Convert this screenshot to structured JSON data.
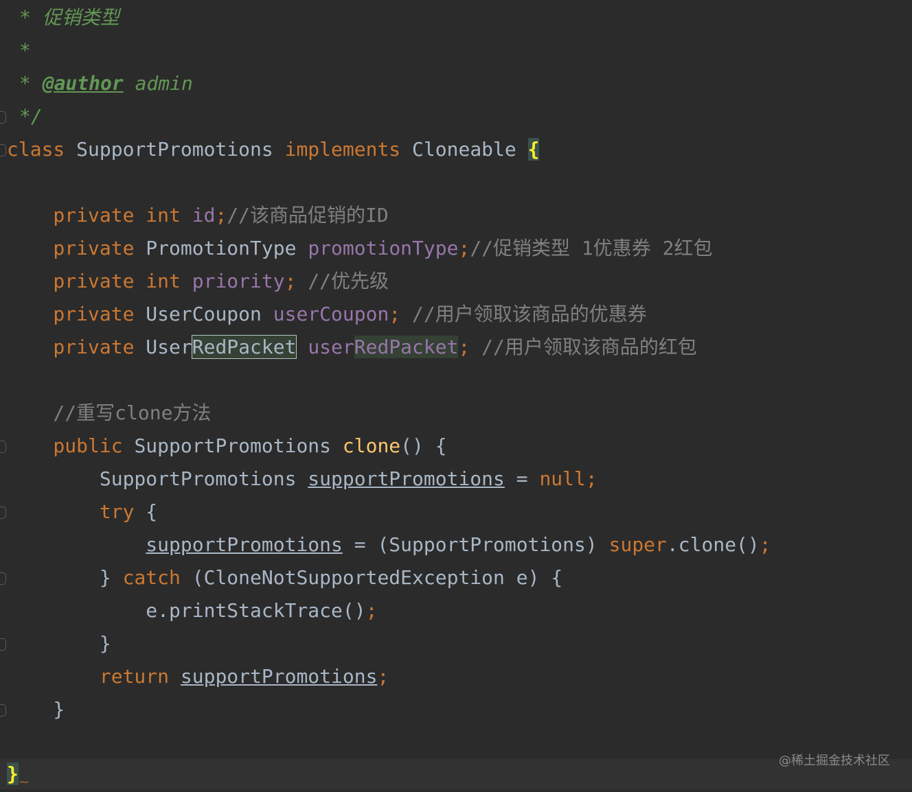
{
  "editor": {
    "lines": [
      {
        "tokens": [
          {
            "t": "* ",
            "c": "doc"
          },
          {
            "t": "促销类型",
            "c": "doc"
          }
        ]
      },
      {
        "tokens": [
          {
            "t": "*",
            "c": "doc"
          }
        ]
      },
      {
        "tokens": [
          {
            "t": "* ",
            "c": "doc"
          },
          {
            "t": "@author",
            "c": "doc-tag"
          },
          {
            "t": " admin",
            "c": "doc"
          }
        ]
      },
      {
        "tokens": [
          {
            "t": "*/",
            "c": "doc"
          }
        ]
      },
      {
        "tokens": [
          {
            "t": "class",
            "c": "kw"
          },
          {
            "t": " SupportPromotions ",
            "c": "cls"
          },
          {
            "t": "implements",
            "c": "kw"
          },
          {
            "t": " Cloneable ",
            "c": "cls"
          },
          {
            "t": "{",
            "c": "brace-match"
          }
        ]
      },
      {
        "tokens": []
      },
      {
        "tokens": [
          {
            "t": "    private ",
            "c": "kw"
          },
          {
            "t": "int ",
            "c": "kw"
          },
          {
            "t": "id",
            "c": "field"
          },
          {
            "t": ";",
            "c": "kw"
          },
          {
            "t": "//该商品促销的ID",
            "c": "cmt"
          }
        ]
      },
      {
        "tokens": [
          {
            "t": "    private ",
            "c": "kw"
          },
          {
            "t": "PromotionType ",
            "c": "cls"
          },
          {
            "t": "promotionType",
            "c": "field"
          },
          {
            "t": ";",
            "c": "kw"
          },
          {
            "t": "//促销类型 1优惠券 2红包",
            "c": "cmt"
          }
        ]
      },
      {
        "tokens": [
          {
            "t": "    private ",
            "c": "kw"
          },
          {
            "t": "int ",
            "c": "kw"
          },
          {
            "t": "priority",
            "c": "field"
          },
          {
            "t": "; ",
            "c": "kw"
          },
          {
            "t": "//优先级",
            "c": "cmt"
          }
        ]
      },
      {
        "tokens": [
          {
            "t": "    private ",
            "c": "kw"
          },
          {
            "t": "UserCoupon ",
            "c": "cls"
          },
          {
            "t": "userCoupon",
            "c": "field"
          },
          {
            "t": "; ",
            "c": "kw"
          },
          {
            "t": "//用户领取该商品的优惠券",
            "c": "cmt"
          }
        ]
      },
      {
        "tokens": [
          {
            "t": "    private ",
            "c": "kw"
          },
          {
            "t": "User",
            "c": "cls"
          },
          {
            "t": "RedPacket",
            "c": "cls hl-box"
          },
          {
            "t": " ",
            "c": "cls"
          },
          {
            "t": "user",
            "c": "field"
          },
          {
            "t": "RedPacket",
            "c": "field hl-fill"
          },
          {
            "t": "; ",
            "c": "kw"
          },
          {
            "t": "//用户领取该商品的红包",
            "c": "cmt"
          }
        ]
      },
      {
        "tokens": []
      },
      {
        "tokens": [
          {
            "t": "    //重写clone方法",
            "c": "cmt"
          }
        ]
      },
      {
        "tokens": [
          {
            "t": "    public ",
            "c": "kw"
          },
          {
            "t": "SupportPromotions ",
            "c": "cls"
          },
          {
            "t": "clone",
            "c": "fn"
          },
          {
            "t": "() {",
            "c": "cls"
          }
        ]
      },
      {
        "tokens": [
          {
            "t": "        SupportPromotions ",
            "c": "cls"
          },
          {
            "t": "supportPromotions",
            "c": "cls ul"
          },
          {
            "t": " = ",
            "c": "cls"
          },
          {
            "t": "null",
            "c": "kw"
          },
          {
            "t": ";",
            "c": "kw"
          }
        ]
      },
      {
        "tokens": [
          {
            "t": "        try ",
            "c": "kw"
          },
          {
            "t": "{",
            "c": "cls"
          }
        ]
      },
      {
        "tokens": [
          {
            "t": "            ",
            "c": "cls"
          },
          {
            "t": "supportPromotions",
            "c": "cls ul"
          },
          {
            "t": " = (SupportPromotions) ",
            "c": "cls"
          },
          {
            "t": "super",
            "c": "kw"
          },
          {
            "t": ".clone()",
            "c": "cls"
          },
          {
            "t": ";",
            "c": "kw"
          }
        ]
      },
      {
        "tokens": [
          {
            "t": "        } ",
            "c": "cls"
          },
          {
            "t": "catch ",
            "c": "kw"
          },
          {
            "t": "(CloneNotSupportedException e) {",
            "c": "cls"
          }
        ]
      },
      {
        "tokens": [
          {
            "t": "            e.printStackTrace()",
            "c": "cls"
          },
          {
            "t": ";",
            "c": "kw"
          }
        ]
      },
      {
        "tokens": [
          {
            "t": "        }",
            "c": "cls"
          }
        ]
      },
      {
        "tokens": [
          {
            "t": "        return ",
            "c": "kw"
          },
          {
            "t": "supportPromotions",
            "c": "cls ul"
          },
          {
            "t": ";",
            "c": "kw"
          }
        ]
      },
      {
        "tokens": [
          {
            "t": "    }",
            "c": "cls"
          }
        ]
      },
      {
        "tokens": []
      },
      {
        "tokens": [
          {
            "t": "}",
            "c": "brace-match"
          }
        ]
      }
    ]
  },
  "watermark": "@稀土掘金技术社区",
  "colors": {
    "background": "#2b2b2b",
    "keyword": "#cc7832",
    "field": "#9876aa",
    "comment": "#808080",
    "doc": "#629755",
    "method": "#ffc66d",
    "text": "#a9b7c6"
  }
}
